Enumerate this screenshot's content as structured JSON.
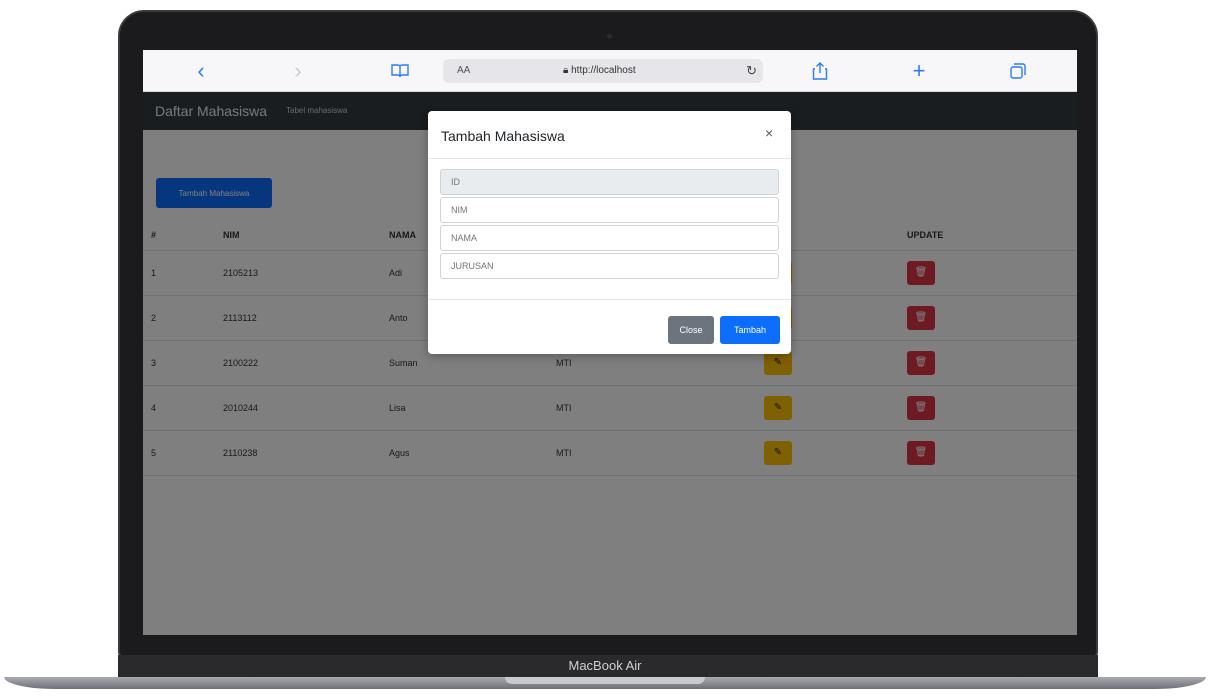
{
  "device": {
    "brand_label": "MacBook Air"
  },
  "browser": {
    "icons": {
      "back": "chevron-left-icon",
      "forward": "chevron-right-icon",
      "bookmarks": "book-icon",
      "reload": "reload-icon",
      "share": "share-icon",
      "new_tab": "plus-icon",
      "tabs": "tabs-icon"
    },
    "address": {
      "aa_label": "AA",
      "url": "http://localhost"
    }
  },
  "navbar": {
    "brand": "Daftar Mahasiswa",
    "link": "Tabel mahasiswa"
  },
  "page": {
    "add_button_label": "Tambah Mahasiswa",
    "table": {
      "headers": {
        "no": "#",
        "nim": "NIM",
        "nama": "NAMA",
        "update": "UPDATE"
      },
      "rows": [
        {
          "no": "1",
          "nim": "2105213",
          "nama": "Adi",
          "jurusan": ""
        },
        {
          "no": "2",
          "nim": "2113112",
          "nama": "Anto",
          "jurusan": ""
        },
        {
          "no": "3",
          "nim": "2100222",
          "nama": "Suman",
          "jurusan": "MTI"
        },
        {
          "no": "4",
          "nim": "2010244",
          "nama": "Lisa",
          "jurusan": "MTI"
        },
        {
          "no": "5",
          "nim": "2110238",
          "nama": "Agus",
          "jurusan": "MTI"
        }
      ]
    },
    "colors": {
      "primary": "#0d6efd",
      "warning": "#ffc107",
      "danger": "#dc3545",
      "navbar": "#343a40"
    }
  },
  "modal": {
    "title": "Tambah Mahasiswa",
    "close_glyph": "×",
    "fields": {
      "id_placeholder": "ID",
      "nim_placeholder": "NIM",
      "nama_placeholder": "NAMA",
      "jurusan_placeholder": "JURUSAN"
    },
    "close_button_label": "Close",
    "submit_button_label": "Tambah"
  }
}
